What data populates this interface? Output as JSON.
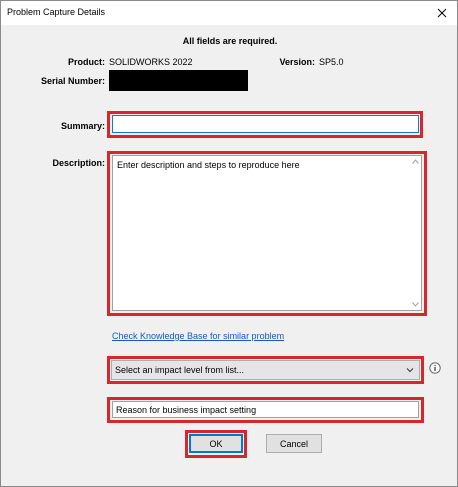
{
  "window": {
    "title": "Problem Capture Details"
  },
  "form": {
    "required_note": "All fields are required.",
    "product_label": "Product:",
    "product_value": "SOLIDWORKS 2022",
    "version_label": "Version:",
    "version_value": "SP5.0",
    "serial_label": "Serial Number:",
    "summary_label": "Summary:",
    "summary_value": "",
    "description_label": "Description:",
    "description_placeholder": "Enter description and steps to reproduce here",
    "kb_link": "Check Knowledge Base for similar problem",
    "impact_select_value": "Select an impact level from list...",
    "reason_placeholder": "Reason for business impact setting"
  },
  "buttons": {
    "ok_label": "OK",
    "cancel_label": "Cancel"
  },
  "icons": {
    "close": "close-icon",
    "chevron": "chevron-down-icon",
    "info": "info-icon"
  },
  "colors": {
    "highlight": "#d8262c",
    "link": "#1a56c7",
    "focus": "#0078d7",
    "redaction": "#000000"
  }
}
